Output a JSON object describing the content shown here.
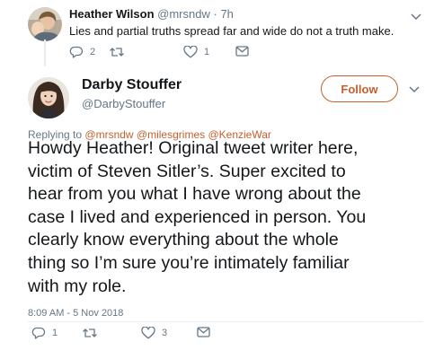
{
  "reply_tweet": {
    "author_name": "Heather Wilson",
    "author_handle": "@mrsndw",
    "separator": "·",
    "time": "7h",
    "text": "Lies and partial truths spread far and wide do not a truth make.",
    "reply_count": "2",
    "retweet_count": "",
    "like_count": "1"
  },
  "main_tweet": {
    "author_name": "Darby Stouffer",
    "author_handle": "@DarbyStouffer",
    "follow_label": "Follow",
    "replying_prefix": "Replying to",
    "mentions": [
      "@mrsndw",
      "@milesgrimes",
      "@KenzieWar"
    ],
    "text_lines": [
      "Howdy Heather! Original tweet writer here,",
      "victim of Steven Sitler’s. Super excited to",
      "hear from you what I have wrong about the",
      "case I lived and experienced in person. You",
      "clearly know everything about the whole",
      "thing so I’m sure you’re intimately familiar",
      "with my role."
    ],
    "timestamp": "8:09 AM - 5 Nov 2018",
    "reply_count": "1",
    "retweet_count": "",
    "like_count": "3"
  },
  "icons": {
    "reply": "reply-icon",
    "retweet": "retweet-icon",
    "like": "heart-icon",
    "message": "envelope-icon",
    "caret": "chevron-down-icon"
  },
  "colors": {
    "accent": "#c4602f",
    "text": "#14171a",
    "secondary_text": "#657786",
    "divider": "#e6ecf0"
  }
}
